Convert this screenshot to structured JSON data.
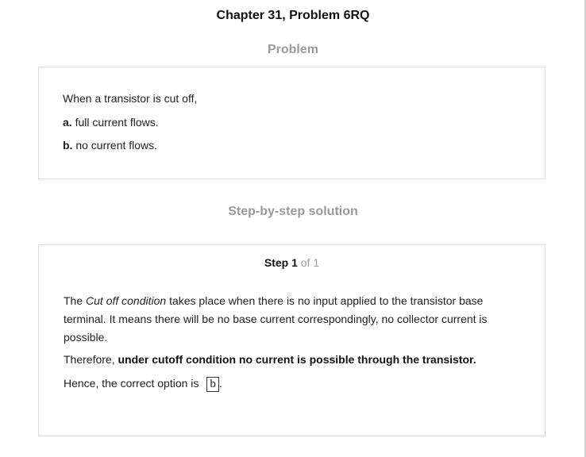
{
  "header": {
    "title": "Chapter 31, Problem 6RQ"
  },
  "problem": {
    "heading": "Problem",
    "question": "When a transistor is cut off,",
    "options": [
      {
        "letter": "a.",
        "text": " full current flows."
      },
      {
        "letter": "b.",
        "text": " no current flows."
      }
    ]
  },
  "solution": {
    "heading": "Step-by-step solution",
    "step_label": "Step 1",
    "step_of": " of 1",
    "para1_prefix": "The ",
    "para1_term": "Cut off condition",
    "para1_rest": " takes place when there is no input applied to the transistor base terminal. It means there will be no base current correspondingly, no collector current is possible.",
    "para2_prefix": "Therefore, ",
    "para2_bold": "under cutoff condition no current is possible through the transistor.",
    "para3_prefix": "Hence, the correct option is ",
    "answer": "b",
    "para3_suffix": "."
  }
}
